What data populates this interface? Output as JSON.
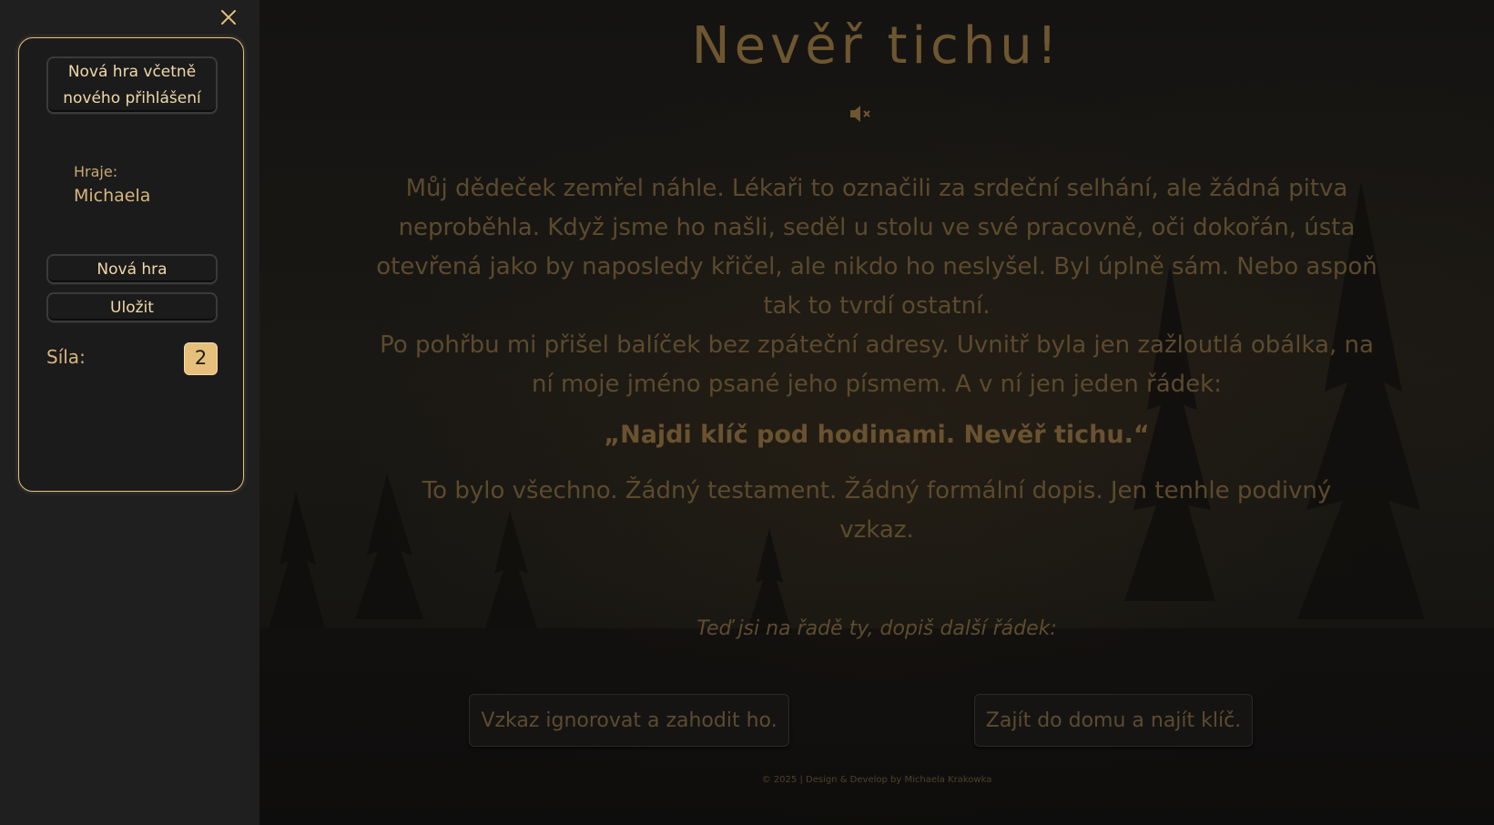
{
  "sidebar": {
    "close_icon": "close-x-icon",
    "new_game_login_line1": "Nová hra včetně",
    "new_game_login_line2": "nového přihlášení",
    "player_label": "Hraje:",
    "player_name": "Michaela",
    "new_game_label": "Nová hra",
    "save_label": "Uložit",
    "strength_label": "Síla:",
    "strength_value": "2"
  },
  "main": {
    "title": "Nevěř tichu!",
    "mute_icon": "speaker-muted-icon",
    "paragraph1": "Můj dědeček zemřel náhle. Lékaři to označili za srdeční selhání, ale žádná pitva neproběhla. Když jsme ho našli, seděl u stolu ve své pracovně, oči dokořán, ústa otevřená jako by naposledy křičel, ale nikdo ho neslyšel. Byl úplně sám. Nebo aspoň tak to tvrdí ostatní.",
    "paragraph2": "Po pohřbu mi přišel balíček bez zpáteční adresy. Uvnitř byla jen zažloutlá obálka, na ní moje jméno psané jeho písmem. A v ní jen jeden řádek:",
    "quote": "„Najdi klíč pod hodinami. Nevěř tichu.“",
    "paragraph3": "To bylo všechno. Žádný testament. Žádný formální dopis. Jen tenhle podivný vzkaz.",
    "prompt": "Teď jsi na řadě ty, dopiš další řádek:",
    "choices": [
      "Vzkaz ignorovat a zahodit ho.",
      "Zajít do domu a najít klíč."
    ],
    "footer": "© 2025 | Design & Develop by Michaela Krakowka"
  },
  "colors": {
    "accent": "#e5bf7b",
    "sidebar_bg": "#1f1f20",
    "main_bg": "#141312",
    "text_dim": "#5c4a2d"
  }
}
